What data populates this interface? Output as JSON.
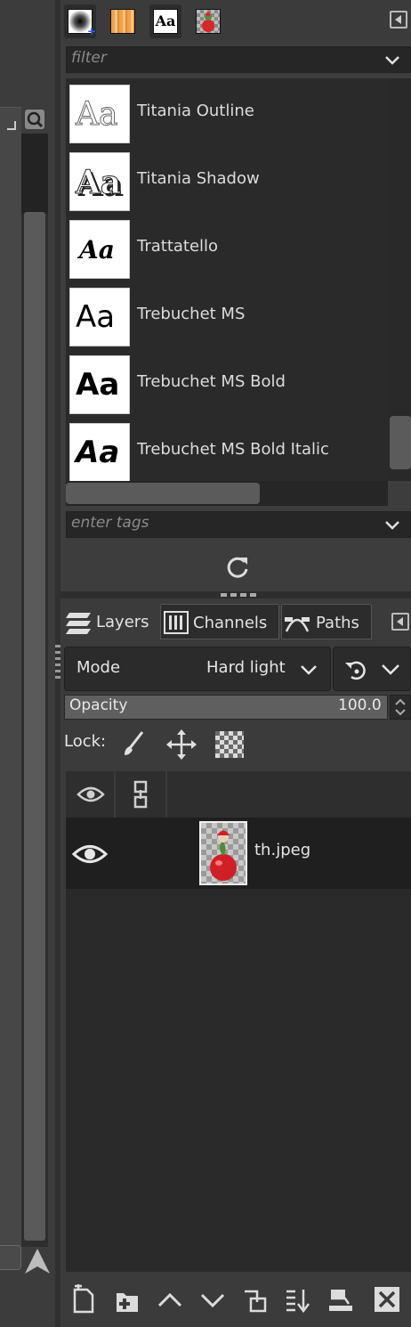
{
  "fonts_panel": {
    "filter_placeholder": "filter",
    "tags_placeholder": "enter tags",
    "fonts": [
      {
        "name": "Titania Outline"
      },
      {
        "name": "Titania Shadow"
      },
      {
        "name": "Trattatello"
      },
      {
        "name": "Trebuchet MS"
      },
      {
        "name": "Trebuchet MS Bold"
      },
      {
        "name": "Trebuchet MS Bold Italic"
      }
    ],
    "preview_text": "Aa"
  },
  "dock_tabs": {
    "fonts_tab_glyph": "Aa"
  },
  "layers_panel": {
    "tabs": [
      {
        "label": "Layers"
      },
      {
        "label": "Channels"
      },
      {
        "label": "Paths"
      }
    ],
    "mode_label": "Mode",
    "mode_value": "Hard light",
    "opacity_label": "Opacity",
    "opacity_value": "100.0",
    "opacity_level": 1.0,
    "lock_label": "Lock:",
    "layers": [
      {
        "name": "th.jpeg",
        "visible": true
      }
    ]
  },
  "colors": {
    "panel_bg": "#3b3b3b",
    "list_bg": "#2a2a2a",
    "selected_row": "#1f1f1f",
    "text": "#e6e6e6",
    "placeholder": "#8b8b8b"
  }
}
